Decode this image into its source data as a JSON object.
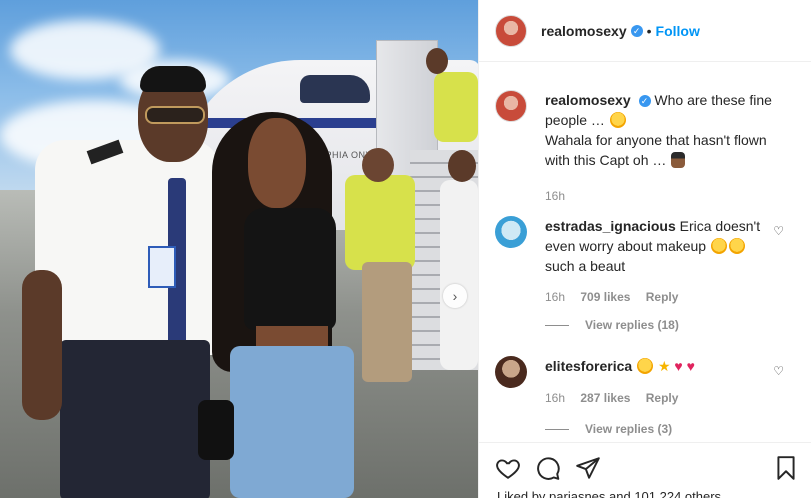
{
  "post": {
    "author": "realomosexy",
    "follow_label": "Follow",
    "separator": "•"
  },
  "caption": {
    "username": "realomosexy",
    "line1": "Who are these fine people …",
    "line2": "Wahala for anyone that hasn't flown with this Capt oh …",
    "time": "16h"
  },
  "photo": {
    "plane_text": "OPHIA ONYE",
    "carousel_next": "›"
  },
  "comments": [
    {
      "username": "estradas_ignacious",
      "text": "Erica doesn't even worry about makeup",
      "text2": "such a beaut",
      "time": "16h",
      "likes": "709 likes",
      "reply": "Reply",
      "view_replies": "View replies (18)"
    },
    {
      "username": "elitesforerica",
      "time": "16h",
      "likes": "287 likes",
      "reply": "Reply",
      "view_replies": "View replies (3)"
    }
  ],
  "footer": {
    "liked_by": "Liked by pariasnes and 101,224 others"
  },
  "colors": {
    "link_blue": "#0095f6",
    "text": "#262626",
    "muted": "#8e8e8e",
    "verified": "#3897f0"
  }
}
